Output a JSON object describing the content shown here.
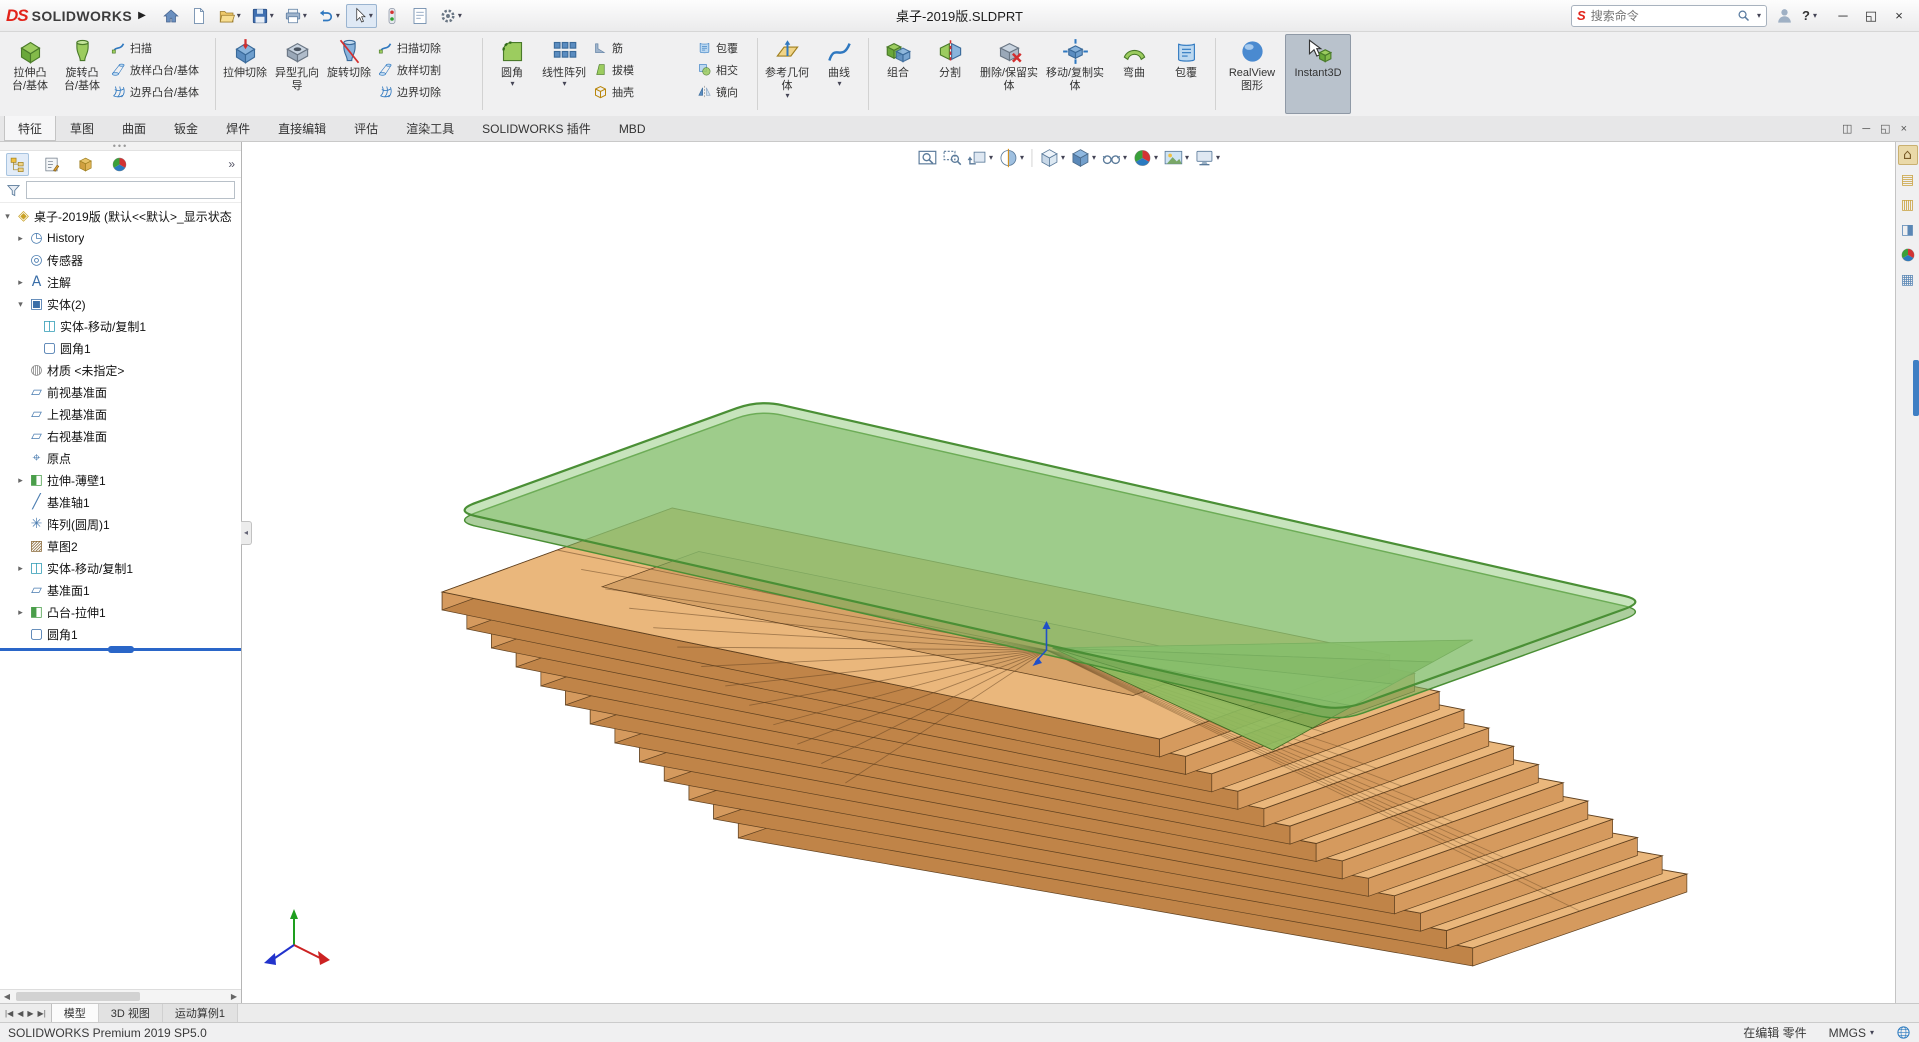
{
  "colors": {
    "accent_blue": "#2a7ac0",
    "ribbon_bg": "#f0f0f1",
    "active_command_bg": "#b9c2cc",
    "rollback_blue": "#2a66c8"
  },
  "titlebar": {
    "logo_mark": "DS",
    "logo_text": "SOLIDWORKS",
    "document_title": "桌子-2019版.SLDPRT",
    "search_placeholder": "搜索命令",
    "help_label": "?",
    "qat": [
      {
        "name": "home"
      },
      {
        "name": "new-document"
      },
      {
        "name": "open",
        "caret": true
      },
      {
        "name": "save",
        "caret": true
      },
      {
        "name": "print",
        "caret": true
      },
      {
        "name": "undo",
        "caret": true
      },
      {
        "name": "select-cursor",
        "caret": true,
        "pressed": true
      },
      {
        "name": "rebuild"
      },
      {
        "name": "file-properties"
      },
      {
        "name": "options-gear",
        "caret": true
      }
    ],
    "window_controls": [
      {
        "name": "minimize",
        "glyph": "─"
      },
      {
        "name": "restore",
        "glyph": "◱"
      },
      {
        "name": "close",
        "glyph": "×"
      }
    ]
  },
  "ribbon": {
    "tabs": [
      {
        "label": "特征",
        "active": true
      },
      {
        "label": "草图"
      },
      {
        "label": "曲面"
      },
      {
        "label": "钣金"
      },
      {
        "label": "焊件"
      },
      {
        "label": "直接编辑"
      },
      {
        "label": "评估"
      },
      {
        "label": "渲染工具"
      },
      {
        "label": "SOLIDWORKS 插件"
      },
      {
        "label": "MBD"
      }
    ],
    "groups": [
      {
        "items": [
          {
            "type": "large",
            "icon": "boss-extrude",
            "label": "拉伸凸台/基体"
          },
          {
            "type": "large",
            "icon": "revolve",
            "label": "旋转凸台/基体"
          },
          {
            "type": "stack",
            "items": [
              {
                "icon": "sweep",
                "label": "扫描"
              },
              {
                "icon": "loft",
                "label": "放样凸台/基体"
              },
              {
                "icon": "boundary",
                "label": "边界凸台/基体"
              }
            ]
          }
        ]
      },
      {
        "items": [
          {
            "type": "large",
            "icon": "cut-extrude",
            "label": "拉伸切除"
          },
          {
            "type": "large",
            "icon": "hole-wizard",
            "label": "异型孔向导"
          },
          {
            "type": "large",
            "icon": "cut-revolve",
            "label": "旋转切除"
          },
          {
            "type": "stack",
            "items": [
              {
                "icon": "cut-sweep",
                "label": "扫描切除"
              },
              {
                "icon": "cut-loft",
                "label": "放样切割"
              },
              {
                "icon": "cut-boundary",
                "label": "边界切除"
              }
            ]
          }
        ]
      },
      {
        "items": [
          {
            "type": "large",
            "icon": "fillet",
            "label": "圆角",
            "caret": true
          },
          {
            "type": "large",
            "icon": "linear-pattern",
            "label": "线性阵列",
            "caret": true
          },
          {
            "type": "stack",
            "items": [
              {
                "icon": "rib",
                "label": "筋"
              },
              {
                "icon": "draft",
                "label": "拔模"
              },
              {
                "icon": "shell",
                "label": "抽壳"
              }
            ]
          },
          {
            "type": "stack",
            "narrow": true,
            "items": [
              {
                "icon": "wrap",
                "label": "包覆"
              },
              {
                "icon": "intersect",
                "label": "相交"
              },
              {
                "icon": "mirror",
                "label": "镜向"
              }
            ]
          }
        ]
      },
      {
        "items": [
          {
            "type": "large",
            "icon": "ref-geometry",
            "label": "参考几何体",
            "caret": true
          },
          {
            "type": "large",
            "icon": "curves",
            "label": "曲线",
            "caret": true
          }
        ]
      },
      {
        "items": [
          {
            "type": "large",
            "icon": "combine",
            "label": "组合"
          },
          {
            "type": "large",
            "icon": "split",
            "label": "分割"
          },
          {
            "type": "large",
            "icon": "delete-keep-body",
            "label": "删除/保留实体",
            "wide": true
          },
          {
            "type": "large",
            "icon": "move-copy-body",
            "label": "移动/复制实体",
            "wide": true
          },
          {
            "type": "large",
            "icon": "flex",
            "label": "弯曲"
          },
          {
            "type": "large",
            "icon": "wrap",
            "label": "包覆"
          }
        ]
      },
      {
        "items": [
          {
            "type": "large",
            "icon": "realview",
            "label": "RealView 图形",
            "wide": true
          },
          {
            "type": "large",
            "icon": "instant3d",
            "label": "Instant3D",
            "active": true,
            "wide": true
          }
        ]
      }
    ]
  },
  "headsup": [
    {
      "icon": "zoom-fit"
    },
    {
      "icon": "zoom-area"
    },
    {
      "icon": "previous-view",
      "caret": true
    },
    {
      "icon": "section-view",
      "caret": true
    },
    {
      "sep": true
    },
    {
      "icon": "view-orientation",
      "caret": true
    },
    {
      "icon": "display-style",
      "caret": true
    },
    {
      "icon": "hide-show-items",
      "caret": true
    },
    {
      "icon": "edit-appearance",
      "caret": true
    },
    {
      "icon": "apply-scene",
      "caret": true
    },
    {
      "icon": "view-settings",
      "caret": true
    }
  ],
  "featuremanager": {
    "tabs": [
      {
        "icon": "feature-tree",
        "active": true
      },
      {
        "icon": "property-manager"
      },
      {
        "icon": "configuration-manager"
      },
      {
        "icon": "display-manager"
      }
    ],
    "chevron": "»",
    "tree": [
      {
        "label": "桌子-2019版 (默认<<默认>_显示状态",
        "icon": "part",
        "indent": 0,
        "expand": "open"
      },
      {
        "label": "History",
        "icon": "history",
        "indent": 1,
        "expand": "closed"
      },
      {
        "label": "传感器",
        "icon": "sensors",
        "indent": 1
      },
      {
        "label": "注解",
        "icon": "annotations",
        "indent": 1,
        "expand": "closed"
      },
      {
        "label": "实体(2)",
        "icon": "solid-bodies",
        "indent": 1,
        "expand": "open"
      },
      {
        "label": "实体-移动/复制1",
        "icon": "body-move-copy",
        "indent": 2
      },
      {
        "label": "圆角1",
        "icon": "fillet-feature",
        "indent": 2
      },
      {
        "label": "材质 <未指定>",
        "icon": "material",
        "indent": 1
      },
      {
        "label": "前视基准面",
        "icon": "plane",
        "indent": 1
      },
      {
        "label": "上视基准面",
        "icon": "plane",
        "indent": 1
      },
      {
        "label": "右视基准面",
        "icon": "plane",
        "indent": 1
      },
      {
        "label": "原点",
        "icon": "origin",
        "indent": 1
      },
      {
        "label": "拉伸-薄壁1",
        "icon": "boss-thin",
        "indent": 1,
        "expand": "closed"
      },
      {
        "label": "基准轴1",
        "icon": "axis",
        "indent": 1
      },
      {
        "label": "阵列(圆周)1",
        "icon": "circular-pattern",
        "indent": 1
      },
      {
        "label": "草图2",
        "icon": "sketch",
        "indent": 1
      },
      {
        "label": "实体-移动/复制1",
        "icon": "body-move-copy",
        "indent": 1,
        "expand": "closed"
      },
      {
        "label": "基准面1",
        "icon": "plane",
        "indent": 1
      },
      {
        "label": "凸台-拉伸1",
        "icon": "boss-extrude-feature",
        "indent": 1,
        "expand": "closed"
      },
      {
        "label": "圆角1",
        "icon": "fillet-feature",
        "indent": 1
      }
    ]
  },
  "taskpane": [
    "solidworks-resources",
    "design-library",
    "file-explorer",
    "view-palette",
    "appearances-scenes",
    "custom-properties"
  ],
  "doc_window_controls": [
    {
      "name": "tile-windows",
      "glyph": "◫"
    },
    {
      "name": "minimize-document",
      "glyph": "─"
    },
    {
      "name": "restore-document",
      "glyph": "◱"
    },
    {
      "name": "close-document",
      "glyph": "×"
    }
  ],
  "doctabs": {
    "nav": [
      "|◀",
      "◀",
      "▶",
      "▶|"
    ],
    "tabs": [
      {
        "label": "模型",
        "active": true
      },
      {
        "label": "3D 视图"
      },
      {
        "label": "运动算例1"
      }
    ]
  },
  "statusbar": {
    "left": "SOLIDWORKS Premium 2019 SP5.0",
    "editing": "在编辑 零件",
    "units": "MMGS"
  },
  "model": {
    "layers": 13,
    "wood_top": "#eab77c",
    "wood_side_near": "#c08448",
    "wood_side_end": "#d59a5e",
    "wood_inner": "#b27a42",
    "wood_edge": "#5f401f",
    "glass_fill": "#8fc97a",
    "glass_side": "#74ad5c",
    "glass_edge": "#4a8f35",
    "origin_color": "#2050c8"
  },
  "icon_map": {
    "home": {
      "sym": "s-home"
    },
    "new-document": {
      "sym": "s-newdoc"
    },
    "open": {
      "sym": "s-open"
    },
    "save": {
      "sym": "s-save"
    },
    "print": {
      "sym": "s-print"
    },
    "undo": {
      "sym": "s-undo"
    },
    "select-cursor": {
      "sym": "s-cursor"
    },
    "rebuild": {
      "sym": "s-rebuild"
    },
    "file-properties": {
      "sym": "s-props"
    },
    "options-gear": {
      "sym": "s-gear"
    },
    "search": {
      "sym": "s-search"
    },
    "user": {
      "sym": "s-user"
    },
    "boss-extrude": {
      "sym": "s-boss"
    },
    "revolve": {
      "sym": "s-revolve"
    },
    "sweep": {
      "sym": "s-sweep"
    },
    "loft": {
      "sym": "s-loft"
    },
    "boundary": {
      "sym": "s-boundary"
    },
    "cut-extrude": {
      "sym": "s-cutex"
    },
    "hole-wizard": {
      "sym": "s-hole"
    },
    "cut-revolve": {
      "sym": "s-cutrev"
    },
    "cut-sweep": {
      "sym": "s-sweep"
    },
    "cut-loft": {
      "sym": "s-loft"
    },
    "cut-boundary": {
      "sym": "s-boundary"
    },
    "fillet": {
      "sym": "s-fillet"
    },
    "linear-pattern": {
      "sym": "s-pattern"
    },
    "rib": {
      "sym": "s-rib"
    },
    "draft": {
      "sym": "s-draft"
    },
    "shell": {
      "sym": "s-shell"
    },
    "wrap": {
      "sym": "s-wrap"
    },
    "intersect": {
      "sym": "s-intersect"
    },
    "mirror": {
      "sym": "s-mirror"
    },
    "ref-geometry": {
      "sym": "s-refgeo"
    },
    "curves": {
      "sym": "s-curve"
    },
    "combine": {
      "sym": "s-combine"
    },
    "split": {
      "sym": "s-split"
    },
    "delete-keep-body": {
      "sym": "s-delbody"
    },
    "move-copy-body": {
      "sym": "s-movebody"
    },
    "flex": {
      "sym": "s-flex"
    },
    "realview": {
      "sym": "s-realview"
    },
    "instant3d": {
      "sym": "s-instant3d"
    },
    "zoom-fit": {
      "sym": "s-zoomfit"
    },
    "zoom-area": {
      "sym": "s-zoomarea"
    },
    "previous-view": {
      "sym": "s-prevview"
    },
    "section-view": {
      "sym": "s-section"
    },
    "view-orientation": {
      "sym": "s-orient"
    },
    "display-style": {
      "sym": "s-display"
    },
    "hide-show-items": {
      "sym": "s-eye"
    },
    "edit-appearance": {
      "sym": "s-colorball"
    },
    "apply-scene": {
      "sym": "s-scene"
    },
    "view-settings": {
      "sym": "s-monitor"
    },
    "feature-tree": {
      "sym": "s-fmtree"
    },
    "property-manager": {
      "sym": "s-propmgr"
    },
    "configuration-manager": {
      "sym": "s-cfgmgr"
    },
    "display-manager": {
      "sym": "s-colorball"
    },
    "tree-filter": {
      "sym": "s-funnel"
    },
    "globe": {
      "sym": "s-globe"
    },
    "part": {
      "ch": "◈",
      "color": "#c9a227"
    },
    "history": {
      "ch": "◷",
      "color": "#4a7cb0"
    },
    "sensors": {
      "ch": "◎",
      "color": "#4a7cb0"
    },
    "annotations": {
      "ch": "A",
      "color": "#3a6ea8"
    },
    "solid-bodies": {
      "ch": "▣",
      "color": "#3a6ea8"
    },
    "body-move-copy": {
      "ch": "◫",
      "color": "#2e9bb5"
    },
    "fillet-feature": {
      "ch": "▢",
      "color": "#3a6ea8"
    },
    "material": {
      "ch": "◍",
      "color": "#888888"
    },
    "plane": {
      "ch": "▱",
      "color": "#4a7cb0"
    },
    "origin": {
      "ch": "⌖",
      "color": "#4a7cb0"
    },
    "boss-thin": {
      "ch": "◧",
      "color": "#4a9e4a"
    },
    "axis": {
      "ch": "╱",
      "color": "#4a7cb0"
    },
    "circular-pattern": {
      "ch": "✳",
      "color": "#4a7cb0"
    },
    "sketch": {
      "ch": "▨",
      "color": "#8a6a3a"
    },
    "boss-extrude-feature": {
      "ch": "◧",
      "color": "#4a9e4a"
    },
    "solidworks-resources": {
      "ch": "⌂",
      "color": "#7a5c28"
    },
    "design-library": {
      "ch": "▤",
      "color": "#c9a23f"
    },
    "file-explorer": {
      "ch": "▥",
      "color": "#c9a23f"
    },
    "view-palette": {
      "ch": "◨",
      "color": "#5a87b5"
    },
    "appearances-scenes": {
      "sym": "s-colorball"
    },
    "custom-properties": {
      "ch": "▦",
      "color": "#5a87b5"
    }
  }
}
